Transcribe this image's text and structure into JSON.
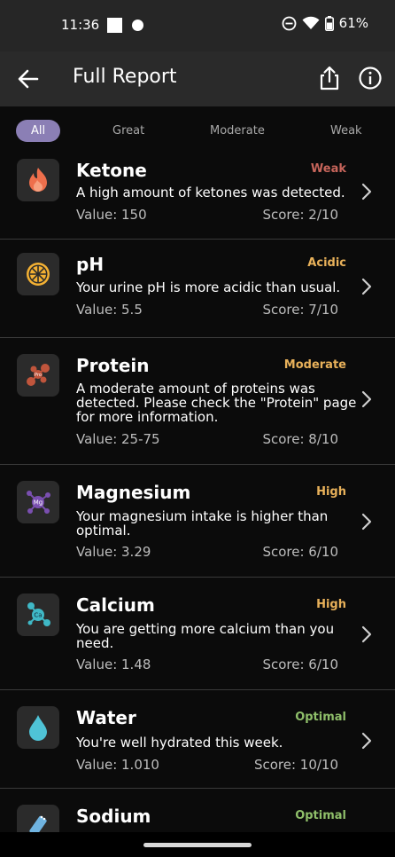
{
  "status_bar": {
    "time": "11:36",
    "battery": "61%"
  },
  "app_bar": {
    "title": "Full Report"
  },
  "filters": [
    "All",
    "Great",
    "Moderate",
    "Weak"
  ],
  "items": [
    {
      "name": "Ketone",
      "status": "Weak",
      "status_color": "#c7655b",
      "desc": "A high amount of ketones was detected.",
      "value": "Value: 150",
      "score": "Score: 2/10",
      "icon": "flame-icon"
    },
    {
      "name": "pH",
      "status": "Acidic",
      "status_color": "#e8b15a",
      "desc": "Your urine pH is more acidic than usual.",
      "value": "Value: 5.5",
      "score": "Score: 7/10",
      "icon": "citrus-icon"
    },
    {
      "name": "Protein",
      "status": "Moderate",
      "status_color": "#e8b15a",
      "desc": "A moderate amount of proteins was detected. Please check the \"Protein\" page for more information.",
      "value": "Value: 25-75",
      "score": "Score: 8/10",
      "icon": "protein-molecule-icon"
    },
    {
      "name": "Magnesium",
      "status": "High",
      "status_color": "#e8b15a",
      "desc": "Your magnesium intake is higher than optimal.",
      "value": "Value: 3.29",
      "score": "Score: 6/10",
      "icon": "magnesium-molecule-icon"
    },
    {
      "name": "Calcium",
      "status": "High",
      "status_color": "#e8b15a",
      "desc": "You are getting more calcium than you need.",
      "value": "Value: 1.48",
      "score": "Score: 6/10",
      "icon": "calcium-molecule-icon"
    },
    {
      "name": "Water",
      "status": "Optimal",
      "status_color": "#8fbf6a",
      "desc": "You're well hydrated this week.",
      "value": "Value: 1.010",
      "score": "Score: 10/10",
      "icon": "water-drop-icon"
    },
    {
      "name": "Sodium",
      "status": "Optimal",
      "status_color": "#8fbf6a",
      "desc": "",
      "value": "",
      "score": "",
      "icon": "salt-shaker-icon"
    }
  ]
}
